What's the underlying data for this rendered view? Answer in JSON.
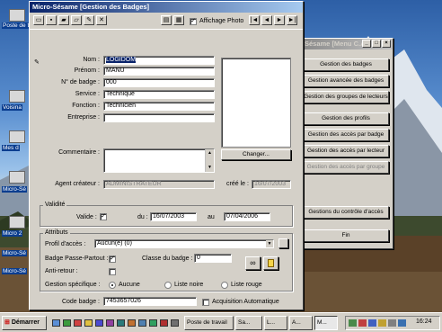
{
  "desktop": {
    "icons": [
      "Poste de t",
      "Voisina",
      "Mes d",
      "Micro-Sé",
      "Micro 2",
      "Micro-Sé",
      "Micro-Sé"
    ]
  },
  "menu_window": {
    "title": "Sésame [Menu C.A.]",
    "buttons": [
      "Gestion des badges",
      "Gestion avancée des badges",
      "Gestion des groupes de lecteurs",
      "Gestion des profils",
      "Gestion des accès par badge",
      "Gestion des accès par lecteur",
      "Gestion des accès par groupe",
      "Gestions du contrôle d'accès",
      "Fin"
    ]
  },
  "badge_window": {
    "title": "Micro-Sésame [Gestion des Badges]",
    "toolbar": {
      "photo_label": "Affichage Photo",
      "photo_checked": "✓"
    },
    "nav": [
      "|◄",
      "◄",
      "►",
      "►|"
    ],
    "form": {
      "nom_label": "Nom :",
      "nom": "LOGIDOM",
      "prenom_label": "Prénom :",
      "prenom": "MANU",
      "badge_label": "N° de badge :",
      "badge": "000",
      "service_label": "Service :",
      "service": "Technique",
      "fonction_label": "Fonction :",
      "fonction": "Technicien",
      "entreprise_label": "Entreprise :",
      "entreprise": "",
      "commentaire_label": "Commentaire :",
      "changer": "Changer...",
      "agent_label": "Agent créateur :",
      "agent": "ADMINISTRATEUR",
      "cree_label": "créé le :",
      "cree": "16/07/2003"
    },
    "validite": {
      "title": "Validité",
      "valide_label": "Valide :",
      "valide": "✓",
      "du_label": "du :",
      "du": "16/07/2003",
      "au_label": "au",
      "au": "07/04/2006"
    },
    "attributs": {
      "title": "Attributs",
      "profil_label": "Profil d'accès :",
      "profil": "Aucun(e) (0)",
      "passe_label": "Badge Passe-Partout :",
      "passe": "✓",
      "classe_label": "Classe du badge :",
      "classe": "0",
      "anti_label": "Anti-retour :",
      "gestion_label": "Gestion spécifique :",
      "radio_options": [
        "Aucune",
        "Liste noire",
        "Liste rouge"
      ]
    },
    "code_label": "Code badge :",
    "code": "7453657026",
    "acq_label": "Acquisition Automatique"
  },
  "taskbar": {
    "start": "Démarrer",
    "items": [
      "Poste de travail",
      "Sa...",
      "L...",
      "A...",
      "M..."
    ],
    "clock": "16:24"
  },
  "colors": {
    "title_active": "#0a246a",
    "selection": "#0a246a",
    "face": "#d4d0c8"
  }
}
